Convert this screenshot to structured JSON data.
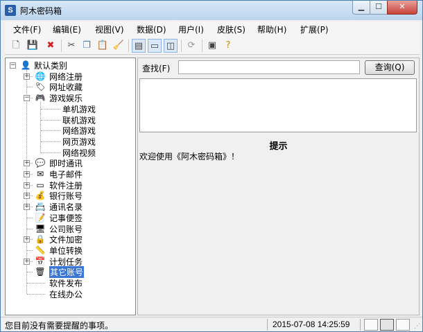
{
  "window": {
    "title": "阿木密码箱",
    "app_icon": "S"
  },
  "menu": [
    "文件(F)",
    "编辑(E)",
    "视图(V)",
    "数据(D)",
    "用户(I)",
    "皮肤(S)",
    "帮助(H)",
    "扩展(P)"
  ],
  "toolbar": {
    "icons": [
      "new-file-icon",
      "save-icon",
      "delete-icon",
      "cut-icon",
      "copy-icon",
      "paste-icon",
      "clear-icon",
      "view-list-icon",
      "view-split-icon",
      "view-detail-icon",
      "refresh-icon",
      "window-icon",
      "help-icon"
    ]
  },
  "tree": {
    "root": "默认类别",
    "nodes": [
      {
        "label": "网络注册",
        "level": 1,
        "expander": "+",
        "icon": "globe-icon",
        "glyph": "🌐"
      },
      {
        "label": "网址收藏",
        "level": 1,
        "expander": "",
        "icon": "tag-icon",
        "glyph": "🏷"
      },
      {
        "label": "游戏娱乐",
        "level": 1,
        "expander": "−",
        "icon": "gamepad-icon",
        "glyph": "🎮"
      },
      {
        "label": "单机游戏",
        "level": 2,
        "expander": "",
        "icon": "",
        "glyph": ""
      },
      {
        "label": "联机游戏",
        "level": 2,
        "expander": "",
        "icon": "",
        "glyph": ""
      },
      {
        "label": "网络游戏",
        "level": 2,
        "expander": "",
        "icon": "",
        "glyph": ""
      },
      {
        "label": "网页游戏",
        "level": 2,
        "expander": "",
        "icon": "",
        "glyph": ""
      },
      {
        "label": "网络视频",
        "level": 2,
        "expander": "",
        "icon": "",
        "glyph": ""
      },
      {
        "label": "即时通讯",
        "level": 1,
        "expander": "+",
        "icon": "chat-icon",
        "glyph": "💬"
      },
      {
        "label": "电子邮件",
        "level": 1,
        "expander": "+",
        "icon": "mail-icon",
        "glyph": "✉"
      },
      {
        "label": "软件注册",
        "level": 1,
        "expander": "+",
        "icon": "software-icon",
        "glyph": "▭"
      },
      {
        "label": "银行账号",
        "level": 1,
        "expander": "+",
        "icon": "money-bag-icon",
        "glyph": "💰"
      },
      {
        "label": "通讯名录",
        "level": 1,
        "expander": "+",
        "icon": "contacts-icon",
        "glyph": "📇"
      },
      {
        "label": "记事便签",
        "level": 1,
        "expander": "",
        "icon": "note-icon",
        "glyph": "📝"
      },
      {
        "label": "公司账号",
        "level": 1,
        "expander": "",
        "icon": "monitor-icon",
        "glyph": "🖥"
      },
      {
        "label": "文件加密",
        "level": 1,
        "expander": "+",
        "icon": "lock-icon",
        "glyph": "🔒"
      },
      {
        "label": "单位转换",
        "level": 1,
        "expander": "",
        "icon": "ruler-icon",
        "glyph": "📏"
      },
      {
        "label": "计划任务",
        "level": 1,
        "expander": "+",
        "icon": "calendar-icon",
        "glyph": "📅"
      },
      {
        "label": "其它账号",
        "level": 1,
        "expander": "",
        "icon": "trash-icon",
        "glyph": "🗑",
        "selected": true
      },
      {
        "label": "软件发布",
        "level": 1,
        "expander": "",
        "icon": "",
        "glyph": ""
      },
      {
        "label": "在线办公",
        "level": 1,
        "expander": "",
        "icon": "",
        "glyph": ""
      }
    ]
  },
  "search": {
    "label": "查找(F)",
    "value": "",
    "button": "查询(Q)"
  },
  "tip": {
    "title": "提示",
    "text": "欢迎使用《阿木密码箱》！"
  },
  "status": {
    "message": "您目前没有需要提醒的事项。",
    "datetime": "2015-07-08 14:25:59"
  }
}
